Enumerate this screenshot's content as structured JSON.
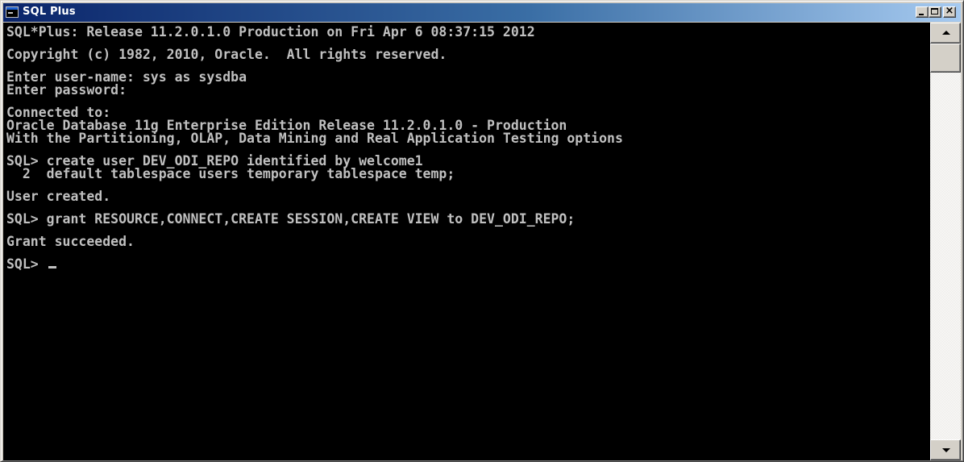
{
  "window": {
    "title": "SQL Plus"
  },
  "console": {
    "lines": [
      "SQL*Plus: Release 11.2.0.1.0 Production on Fri Apr 6 08:37:15 2012",
      "",
      "Copyright (c) 1982, 2010, Oracle.  All rights reserved.",
      "",
      "Enter user-name: sys as sysdba",
      "Enter password:",
      "",
      "Connected to:",
      "Oracle Database 11g Enterprise Edition Release 11.2.0.1.0 - Production",
      "With the Partitioning, OLAP, Data Mining and Real Application Testing options",
      "",
      "SQL> create user DEV_ODI_REPO identified by welcome1",
      "  2  default tablespace users temporary tablespace temp;",
      "",
      "User created.",
      "",
      "SQL> grant RESOURCE,CONNECT,CREATE SESSION,CREATE VIEW to DEV_ODI_REPO;",
      "",
      "Grant succeeded.",
      "",
      "SQL> "
    ]
  },
  "colors": {
    "console_background": "#000000",
    "console_text": "#c0c0c0",
    "titlebar_start": "#0a246a",
    "titlebar_end": "#a6caf0"
  },
  "icons": {
    "app": "sqlplus-console-icon",
    "minimize": "minimize-icon",
    "maximize": "maximize-icon",
    "close": "close-icon",
    "scroll_up": "scroll-up-arrow-icon",
    "scroll_down": "scroll-down-arrow-icon"
  }
}
